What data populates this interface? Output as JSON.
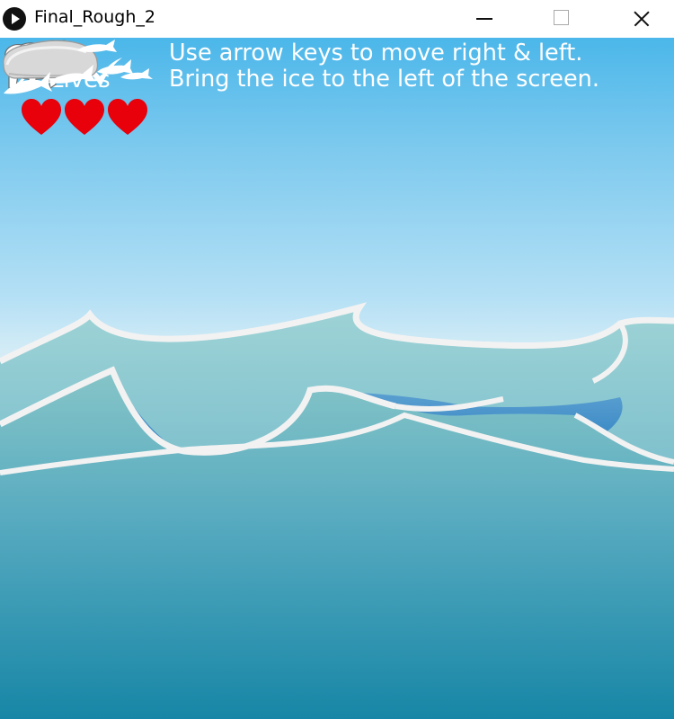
{
  "window": {
    "title": "Final_Rough_2",
    "controls": [
      "minimize-icon",
      "maximize-icon",
      "close-icon"
    ]
  },
  "hud": {
    "lives_label": "Lives",
    "lives_count": 3,
    "heart_color": "#e8000b",
    "instruction_line1": "Use arrow keys to move right & left.",
    "instruction_line2": "Bring the ice to the left of the screen."
  },
  "scene": {
    "sky_colors": [
      "#4bb7ea",
      "#b5e0f5"
    ],
    "sea_colors": [
      "#7fc1c4",
      "#1a8aa8"
    ],
    "wave_outline_color": "#f2f2f2",
    "sprites": [
      "bird-icon",
      "polar-bear",
      "ice-block",
      "fish-icon"
    ]
  }
}
